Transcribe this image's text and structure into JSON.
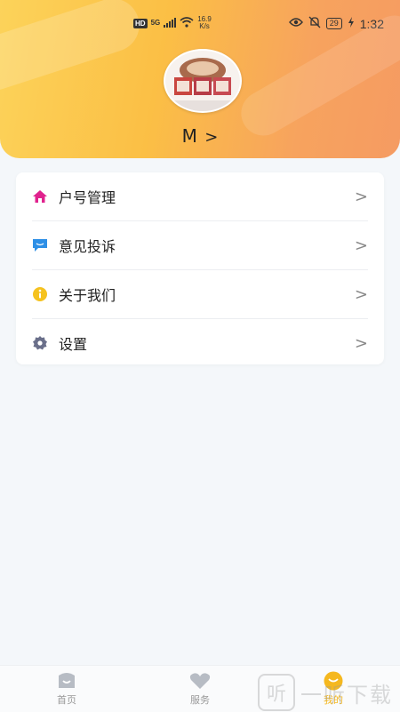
{
  "status_bar": {
    "hd": "HD",
    "signal": "5G",
    "net_speed": "16.9",
    "net_unit": "K/s",
    "battery": "29",
    "time": "1:32"
  },
  "profile": {
    "name": "M",
    "chevron": ">"
  },
  "menu": [
    {
      "label": "户号管理",
      "icon": "home-icon",
      "color": "#e0228e"
    },
    {
      "label": "意见投诉",
      "icon": "chat-icon",
      "color": "#2d8fe6"
    },
    {
      "label": "关于我们",
      "icon": "info-icon",
      "color": "#f5c21f"
    },
    {
      "label": "设置",
      "icon": "gear-icon",
      "color": "#6a6f8a"
    }
  ],
  "chevron": ">",
  "bottom_nav": [
    {
      "label": "首页",
      "icon": "home-tab-icon",
      "active": false
    },
    {
      "label": "服务",
      "icon": "heart-icon",
      "active": false
    },
    {
      "label": "我的",
      "icon": "profile-tab-icon",
      "active": true
    }
  ],
  "watermark": {
    "glyph": "听",
    "text": "一听下载"
  },
  "colors": {
    "accent": "#f5b81f",
    "header_start": "#fcd35a",
    "header_end": "#f59b62"
  }
}
